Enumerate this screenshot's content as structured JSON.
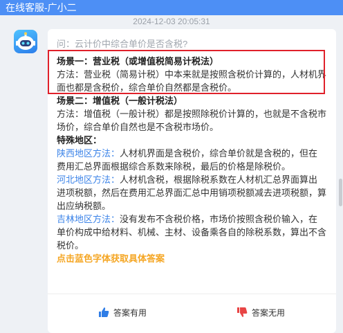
{
  "window": {
    "title": "在线客服-广小二"
  },
  "chat": {
    "timestamp": "2024-12-03 20:05:31",
    "question": "问：云计价中综合单价是否含税?",
    "scene1": {
      "title": "场景一：营业税（或增值税简易计税法）",
      "body": "方法：营业税（简易计税）中本来就是按照含税价计算的，人材机界面也都是含税价，综合单价自然都是含税价。"
    },
    "scene2": {
      "title": "场景二：增值税（一般计税法）",
      "body": "方法：增值税（一般计税）都是按照除税价计算的，也就是不含税市场价，综合单价自然也是不含税市场价。"
    },
    "special": {
      "title": "特殊地区：",
      "regions": [
        {
          "link": "陕西地区方法：",
          "text": "人材机界面是含税价，综合单价就是含税的，但在费用汇总界面根据综合系数来除税，最后的价格是除税价。"
        },
        {
          "link": "河北地区方法：",
          "text": "人材机含税，根据除税系数在人材机汇总界面算出进项税额，然后在费用汇总界面汇总中用销项税额减去进项税额，算出应纳税额。"
        },
        {
          "link": "吉林地区方法：",
          "text": "没有发布不含税价格，市场价按照含税价输入，在单价构成中给材料、机械、主材、设备乘各自的除税系数，算出不含税价。"
        }
      ]
    },
    "cta": "点击蓝色字体获取具体答案"
  },
  "feedback": {
    "useful_label": "答案有用",
    "useless_label": "答案无用",
    "useful_icon": "thumbs-up-icon",
    "useless_icon": "thumbs-down-icon"
  },
  "colors": {
    "titlebar": "#4d8ff5",
    "link": "#3b83e8",
    "cta": "#f5a623",
    "highlight": "#e0202a",
    "thumb_up": "#2f7de6",
    "thumb_down": "#e84545"
  }
}
